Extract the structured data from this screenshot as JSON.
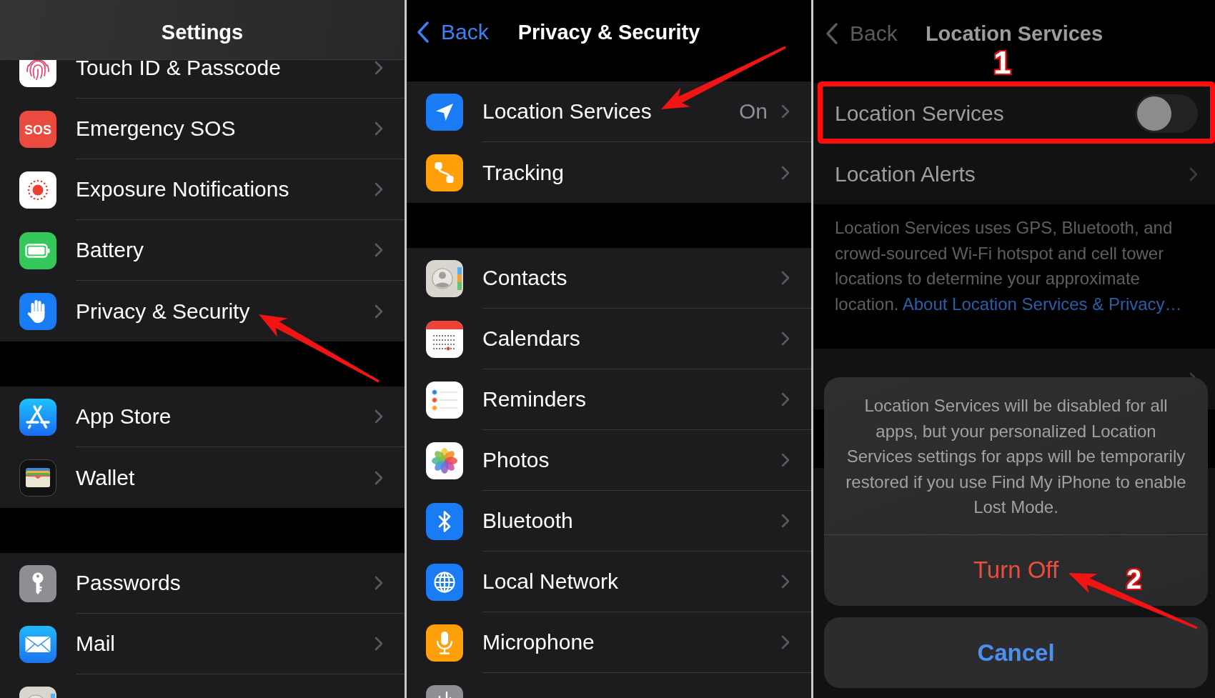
{
  "settings_screen": {
    "title": "Settings",
    "groups": [
      {
        "rows": [
          {
            "label": "Touch ID & Passcode",
            "chevron": true
          },
          {
            "label": "Emergency SOS",
            "icon_text": "SOS",
            "chevron": true
          },
          {
            "label": "Exposure Notifications",
            "chevron": true
          },
          {
            "label": "Battery",
            "chevron": true
          },
          {
            "label": "Privacy & Security",
            "chevron": true
          }
        ]
      },
      {
        "rows": [
          {
            "label": "App Store",
            "chevron": true
          },
          {
            "label": "Wallet",
            "chevron": true
          }
        ]
      },
      {
        "rows": [
          {
            "label": "Passwords",
            "chevron": true
          },
          {
            "label": "Mail",
            "chevron": true
          },
          {
            "chevron": false
          }
        ]
      }
    ]
  },
  "privacy_screen": {
    "back": "Back",
    "title": "Privacy & Security",
    "groups": [
      {
        "rows": [
          {
            "label": "Location Services",
            "value": "On",
            "chevron": true
          },
          {
            "label": "Tracking",
            "chevron": true
          }
        ]
      },
      {
        "rows": [
          {
            "label": "Contacts",
            "chevron": true
          },
          {
            "label": "Calendars",
            "chevron": true
          },
          {
            "label": "Reminders",
            "chevron": true
          },
          {
            "label": "Photos",
            "chevron": true
          },
          {
            "label": "Bluetooth",
            "chevron": true
          },
          {
            "label": "Local Network",
            "chevron": true
          },
          {
            "label": "Microphone",
            "chevron": true
          },
          {
            "chevron": false
          }
        ]
      }
    ]
  },
  "location_screen": {
    "back": "Back",
    "title": "Location Services",
    "groups": [
      {
        "rows": [
          {
            "kind": "toggle",
            "label": "Location Services",
            "on": false
          },
          {
            "kind": "link",
            "label": "Location Alerts"
          }
        ],
        "footer": {
          "text": "Location Services uses GPS, Bluetooth, and crowd-sourced Wi-Fi hotspot and cell tower locations to determine your approximate location.",
          "link": "About Location Services & Privacy…"
        }
      },
      {
        "rows": [
          {
            "kind": "link"
          }
        ]
      }
    ],
    "action_sheet": {
      "message": "Location Services will be disabled for all apps, but your personalized Location Services settings for apps will be temporarily restored if you use Find My iPhone to enable Lost Mode.",
      "buttons": [
        {
          "label": "Turn Off",
          "kind": "destructive"
        },
        {
          "label": "Cancel",
          "kind": "cancel"
        }
      ]
    }
  },
  "annotations": {
    "step_numbers": [
      "1",
      "2"
    ]
  }
}
